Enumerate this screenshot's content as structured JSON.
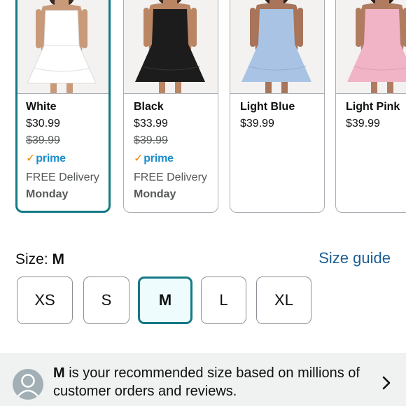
{
  "variants": [
    {
      "color": "White",
      "price": "$30.99",
      "list_price": "$39.99",
      "prime_label": "prime",
      "delivery": "FREE Delivery",
      "delivery_day": "Monday",
      "swatch": "#ffffff",
      "selected": true
    },
    {
      "color": "Black",
      "price": "$33.99",
      "list_price": "$39.99",
      "prime_label": "prime",
      "delivery": "FREE Delivery",
      "delivery_day": "Monday",
      "swatch": "#1c1c1c",
      "selected": false
    },
    {
      "color": "Light Blue",
      "price": "$39.99",
      "swatch": "#a9c3e4",
      "selected": false
    },
    {
      "color": "Light Pink",
      "price": "$39.99",
      "swatch": "#f1b4c6",
      "selected": false
    }
  ],
  "size": {
    "label": "Size:",
    "selected_value": "M",
    "guide_link": "Size guide",
    "options": [
      "XS",
      "S",
      "M",
      "L",
      "XL"
    ]
  },
  "recommendation": {
    "size": "M",
    "text": "is your recommended size based on millions of customer orders and reviews.",
    "icon": "user-avatar-icon",
    "chevron": "chevron-right-icon"
  },
  "colors": {
    "accent": "#137a85",
    "link": "#1b5e93",
    "prime_blue": "#1a8cc8",
    "prime_check": "#f08804"
  }
}
